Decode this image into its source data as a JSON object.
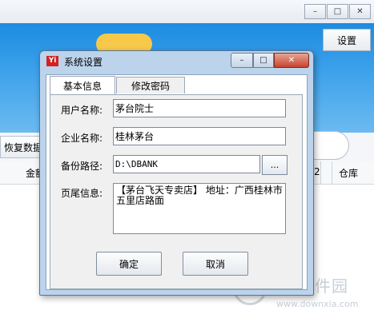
{
  "background": {
    "settings_label": "设置",
    "restore_label": "恢复数据",
    "columns": [
      "金额",
      "2",
      "仓库"
    ]
  },
  "watermark": {
    "main": "当下软件园",
    "sub": "www.downxia.com"
  },
  "dialog": {
    "title": "系统设置",
    "app_icon_text": "Yi",
    "tabs": [
      "基本信息",
      "修改密码"
    ],
    "active_tab": "基本信息",
    "fields": {
      "username_label": "用户名称:",
      "username_value": "茅台院士",
      "company_label": "企业名称:",
      "company_value": "桂林茅台",
      "backup_label": "备份路径:",
      "backup_value": "D:\\DBANK",
      "browse_label": "...",
      "footer_label": "页尾信息:",
      "footer_value": "【茅台飞天专卖店】 地址：广西桂林市五里店路面"
    },
    "ok_label": "确定",
    "cancel_label": "取消"
  },
  "colors": {
    "banner": "#1c8be0",
    "dialog_frame": "#bcd3ec",
    "close_button": "#c7432f"
  }
}
